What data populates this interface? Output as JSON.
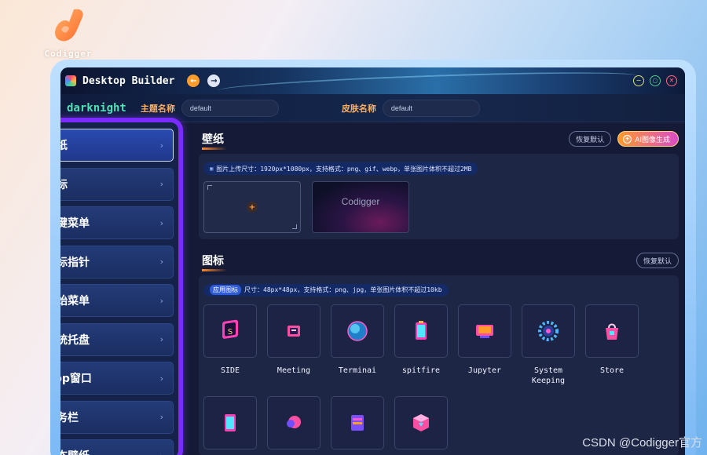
{
  "brand": {
    "name": "Codigger"
  },
  "window": {
    "title": "Desktop Builder",
    "nav": {
      "back_icon": "←",
      "forward_icon": "→"
    },
    "controls": {
      "minimize": "−",
      "maximize": "○",
      "close": "✕"
    }
  },
  "theme_bar": {
    "theme_name": "darknight",
    "theme_label": "主题名称",
    "theme_value": "default",
    "skin_label": "皮肤名称",
    "skin_value": "default"
  },
  "sidebar": {
    "items": [
      {
        "label": "壁纸",
        "active": true
      },
      {
        "label": "图标"
      },
      {
        "label": "右键菜单"
      },
      {
        "label": "鼠标指针"
      },
      {
        "label": "开始菜单"
      },
      {
        "label": "系统托盘"
      },
      {
        "label": "App窗口"
      },
      {
        "label": "任务栏"
      },
      {
        "label": "动态壁纸"
      }
    ],
    "chevron": "›"
  },
  "wallpaper_section": {
    "title": "壁纸",
    "reset_label": "恢复默认",
    "ai_label": "AI图像生成",
    "hint": "图片上传尺寸：1920px*1080px，支持格式：png、gif、webp，单张图片体积不超过2MB",
    "upload_plus": "+",
    "thumb_label": "Codigger"
  },
  "icon_section": {
    "title": "图标",
    "reset_label": "恢复默认",
    "hint_tag": "应用图标",
    "hint": "尺寸：48px*48px，支持格式：png、jpg，单张图片体积不超过10kb",
    "icons": [
      {
        "name": "SIDE",
        "icon": "side-icon"
      },
      {
        "name": "Meeting",
        "icon": "meeting-icon"
      },
      {
        "name": "Terminai",
        "icon": "terminal-icon"
      },
      {
        "name": "spitfire",
        "icon": "spitfire-icon"
      },
      {
        "name": "Jupyter",
        "icon": "jupyter-icon"
      },
      {
        "name": "System\nKeeping",
        "icon": "gear-icon"
      },
      {
        "name": "Store",
        "icon": "store-icon"
      }
    ]
  },
  "watermark": "CSDN @Codigger官方",
  "colors": {
    "accent_purple": "#7a2cff",
    "theme_green": "#4fe0b5",
    "label_orange": "#ffb060"
  }
}
